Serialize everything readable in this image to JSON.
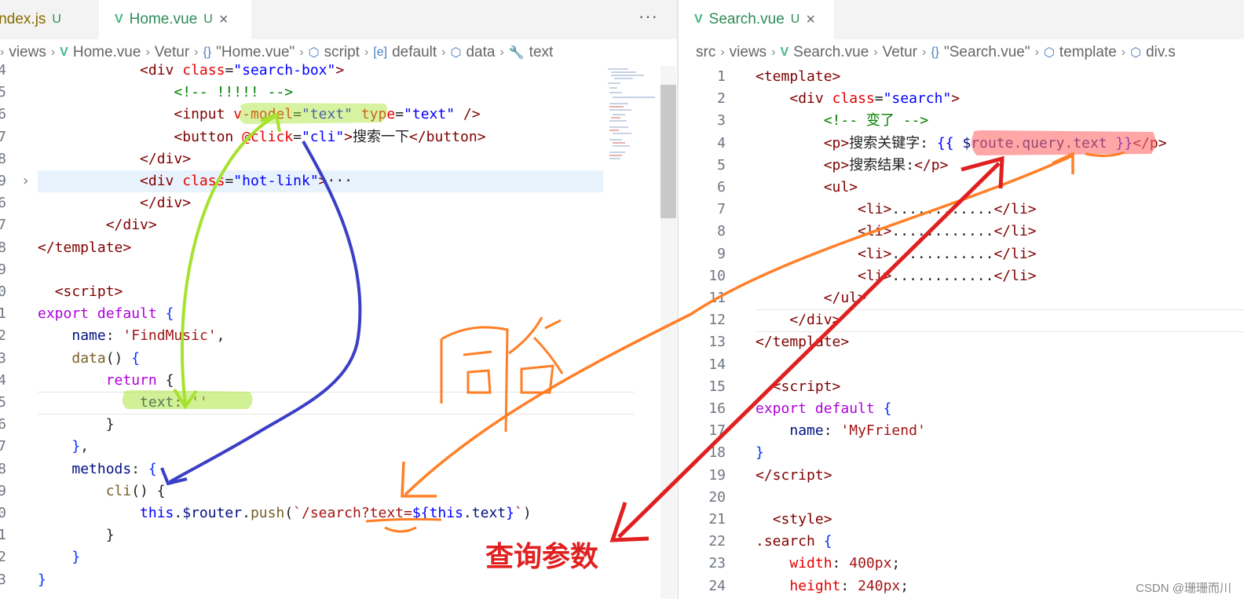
{
  "left": {
    "tabs": [
      {
        "name": "index.js",
        "badge": "U"
      },
      {
        "name": "Home.vue",
        "badge": "U",
        "close": "×"
      }
    ],
    "more": "···",
    "breadcrumb": [
      {
        "icon": "",
        "text": "views"
      },
      {
        "icon": "V",
        "text": "Home.vue"
      },
      {
        "icon": "",
        "text": "Vetur"
      },
      {
        "icon": "{}",
        "text": "\"Home.vue\""
      },
      {
        "icon": "⬡",
        "text": "script"
      },
      {
        "icon": "[e]",
        "text": "default"
      },
      {
        "icon": "⬡",
        "text": "data"
      },
      {
        "icon": "🔧",
        "text": "text"
      }
    ]
  },
  "right": {
    "tabs": [
      {
        "name": "Search.vue",
        "badge": "U",
        "close": "×"
      }
    ],
    "breadcrumb": [
      {
        "icon": "",
        "text": "src"
      },
      {
        "icon": "",
        "text": "views"
      },
      {
        "icon": "V",
        "text": "Search.vue"
      },
      {
        "icon": "",
        "text": "Vetur"
      },
      {
        "icon": "{}",
        "text": "\"Search.vue\""
      },
      {
        "icon": "⬡",
        "text": "template"
      },
      {
        "icon": "⬡",
        "text": "div.s"
      }
    ]
  },
  "left_lines": [
    {
      "n": "4",
      "html": "            <span class='t'>&lt;div</span> <span class='a'>class</span>=<span class='s'>\"search-box\"</span><span class='t'>&gt;</span>"
    },
    {
      "n": "5",
      "html": "                <span class='c'>&lt;!-- !!!!! --&gt;</span>"
    },
    {
      "n": "6",
      "html": "                <span class='t'>&lt;input</span> <span class='a'>v-model</span>=<span class='s'>\"text\"</span> <span class='a'>type</span>=<span class='s'>\"text\"</span> <span class='t'>/&gt;</span>"
    },
    {
      "n": "7",
      "html": "                <span class='t'>&lt;button</span> <span class='a'>@click</span>=<span class='s'>\"cli\"</span><span class='t'>&gt;</span>搜索一下<span class='t'>&lt;/button&gt;</span>"
    },
    {
      "n": "8",
      "html": "            <span class='t'>&lt;/div&gt;</span>"
    },
    {
      "n": "9",
      "html": "            <span class='t'>&lt;div</span> <span class='a'>class</span>=<span class='s'>\"hot-link\"</span><span class='t'>&gt;</span>···"
    },
    {
      "n": "6",
      "html": "            <span class='t'>&lt;/div&gt;</span>"
    },
    {
      "n": "7",
      "html": "        <span class='t'>&lt;/div&gt;</span>"
    },
    {
      "n": "8",
      "html": "<span class='t'>&lt;/template&gt;</span>"
    },
    {
      "n": "9",
      "html": ""
    },
    {
      "n": "0",
      "html": "  <span class='t'>&lt;script&gt;</span>"
    },
    {
      "n": "1",
      "html": "<span class='k'>export</span> <span class='k'>default</span> <span class='br'>{</span>"
    },
    {
      "n": "2",
      "html": "    <span class='p'>name</span>: <span class='st'>'FindMusic'</span>,"
    },
    {
      "n": "3",
      "html": "    <span class='f'>data</span>() <span class='br'>{</span>"
    },
    {
      "n": "4",
      "html": "        <span class='k'>return</span> {"
    },
    {
      "n": "5",
      "html": "            <span class='p'>text</span>: <span class='st'>''</span>"
    },
    {
      "n": "6",
      "html": "        }"
    },
    {
      "n": "7",
      "html": "    <span class='br'>}</span>,"
    },
    {
      "n": "8",
      "html": "    <span class='p'>methods</span>: <span class='br'>{</span>"
    },
    {
      "n": "9",
      "html": "        <span class='f'>cli</span>() {"
    },
    {
      "n": "0",
      "html": "            <span class='kb'>this</span>.<span class='p'>$router</span>.<span class='f'>push</span>(<span class='st'>`/search?text=</span><span class='kb'>${</span><span class='kb'>this</span>.<span class='p'>text</span><span class='kb'>}</span><span class='st'>`</span>)"
    },
    {
      "n": "1",
      "html": "        }"
    },
    {
      "n": "2",
      "html": "    <span class='br'>}</span>"
    },
    {
      "n": "3",
      "html": "<span class='br'>}</span>"
    }
  ],
  "right_lines": [
    {
      "n": "1",
      "html": "<span class='t'>&lt;template&gt;</span>"
    },
    {
      "n": "2",
      "html": "    <span class='t'>&lt;div</span> <span class='a'>class</span>=<span class='s'>\"search\"</span><span class='t'>&gt;</span>"
    },
    {
      "n": "3",
      "html": "        <span class='c'>&lt;!-- 变了 --&gt;</span>"
    },
    {
      "n": "4",
      "html": "        <span class='t'>&lt;p&gt;</span>搜索关键字: <span class='kb'>{{</span> <span class='p'>$route</span>.<span class='p'>query</span>.<span class='p'>text</span> <span class='kb'>}}</span><span class='t'>&lt;/p&gt;</span>"
    },
    {
      "n": "5",
      "html": "        <span class='t'>&lt;p&gt;</span>搜索结果:<span class='t'>&lt;/p&gt;</span>"
    },
    {
      "n": "6",
      "html": "        <span class='t'>&lt;ul&gt;</span>"
    },
    {
      "n": "7",
      "html": "            <span class='t'>&lt;li&gt;</span>............<span class='t'>&lt;/li&gt;</span>"
    },
    {
      "n": "8",
      "html": "            <span class='t'>&lt;li&gt;</span>............<span class='t'>&lt;/li&gt;</span>"
    },
    {
      "n": "9",
      "html": "            <span class='t'>&lt;li&gt;</span>............<span class='t'>&lt;/li&gt;</span>"
    },
    {
      "n": "10",
      "html": "            <span class='t'>&lt;li&gt;</span>............<span class='t'>&lt;/li&gt;</span>"
    },
    {
      "n": "11",
      "html": "        <span class='t'>&lt;/ul&gt;</span>"
    },
    {
      "n": "12",
      "html": "    <span class='t'>&lt;/div&gt;</span>"
    },
    {
      "n": "13",
      "html": "<span class='t'>&lt;/template&gt;</span>"
    },
    {
      "n": "14",
      "html": ""
    },
    {
      "n": "15",
      "html": "  <span class='t'>&lt;script&gt;</span>"
    },
    {
      "n": "16",
      "html": "<span class='k'>export</span> <span class='k'>default</span> <span class='br'>{</span>"
    },
    {
      "n": "17",
      "html": "    <span class='p'>name</span>: <span class='st'>'MyFriend'</span>"
    },
    {
      "n": "18",
      "html": "<span class='br'>}</span>"
    },
    {
      "n": "19",
      "html": "<span class='t'>&lt;/script&gt;</span>"
    },
    {
      "n": "20",
      "html": ""
    },
    {
      "n": "21",
      "html": "  <span class='t'>&lt;style&gt;</span>"
    },
    {
      "n": "22",
      "html": "<span class='t'>.search</span> <span class='br'>{</span>"
    },
    {
      "n": "23",
      "html": "    <span class='a'>width</span>: <span class='st'>400px</span>;"
    },
    {
      "n": "24",
      "html": "    <span class='a'>height</span>: <span class='st'>240px</span>;"
    }
  ],
  "annotations": {
    "handwritten": "同名",
    "label": "查询参数"
  },
  "watermark": "CSDN @珊珊而川",
  "colors": {
    "annot_green": "#a6e22e",
    "annot_blue": "#3b3fc6",
    "annot_orange": "#ff7f27",
    "annot_red": "#e02020",
    "line_highlight": "#e8f2fc"
  }
}
